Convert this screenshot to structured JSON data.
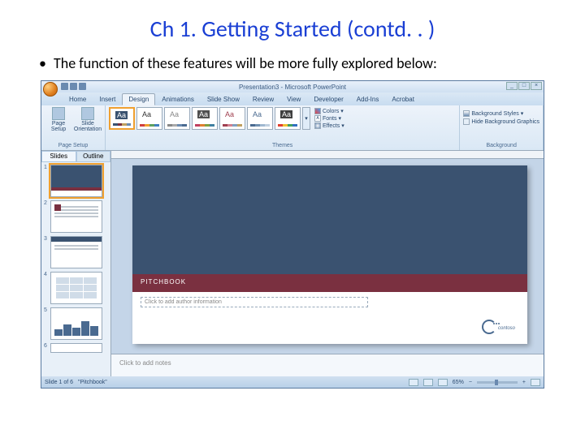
{
  "slide": {
    "title": "Ch 1. Getting Started (contd. . )",
    "bullet": "The function of these features will be more fully explored below:"
  },
  "ppt": {
    "titlebar": "Presentation3 - Microsoft PowerPoint",
    "tabs": [
      "Home",
      "Insert",
      "Design",
      "Animations",
      "Slide Show",
      "Review",
      "View",
      "Developer",
      "Add-Ins",
      "Acrobat"
    ],
    "active_tab": "Design",
    "ribbon": {
      "page_setup": {
        "btn1": "Page Setup",
        "btn2": "Slide Orientation",
        "title": "Page Setup"
      },
      "themes": {
        "title": "Themes",
        "colors": "Colors",
        "fonts": "Fonts",
        "effects": "Effects"
      },
      "background": {
        "styles": "Background Styles",
        "hide": "Hide Background Graphics",
        "title": "Background"
      }
    },
    "leftpane": {
      "tab_slides": "Slides",
      "tab_outline": "Outline"
    },
    "canvas": {
      "band_text": "PITCHBOOK",
      "placeholder": "Click to add author information",
      "logo_text": "contoso"
    },
    "notes": "Click to add notes",
    "status": {
      "left": "Slide 1 of 6",
      "theme": "\"Pitchbook\"",
      "zoom": "65%"
    }
  }
}
